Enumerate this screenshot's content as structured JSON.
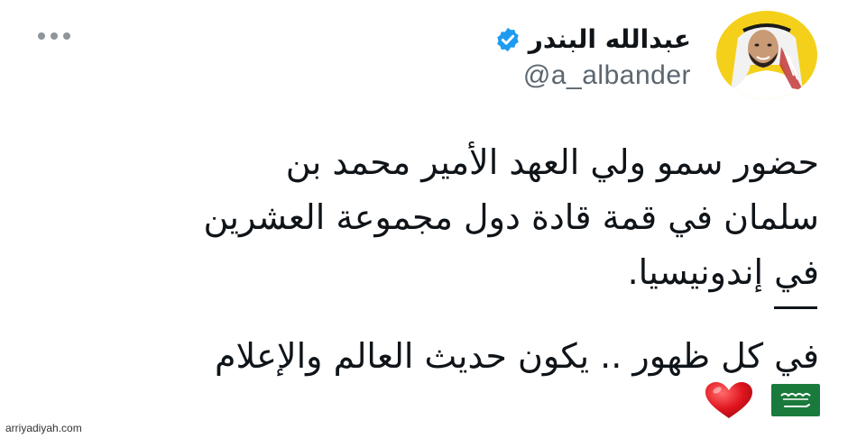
{
  "tweet": {
    "display_name": "عبدالله البندر",
    "handle": "@a_albander",
    "verified": true,
    "verified_color": "#1d9bf0",
    "avatar_bg_color": "#f4d01b",
    "body_lines": [
      "حضور سمو ولي العهد الأمير محمد بن",
      "سلمان في قمة قادة دول مجموعة العشرين",
      "في إندونيسيا."
    ],
    "divider": "—",
    "second_line": "في كل ظهور .. يكون حديث العالم والإعلام",
    "emojis": [
      "heart-emoji",
      "saudi-flag-emoji"
    ]
  },
  "icons": {
    "more": "more-options-icon",
    "verified": "verified-badge-icon"
  },
  "watermark": "arriyadiyah.com"
}
